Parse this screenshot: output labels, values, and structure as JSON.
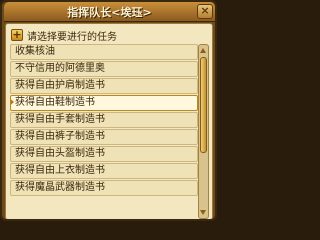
{
  "window": {
    "title": "指挥队长<埃珏>",
    "close_glyph": "×"
  },
  "prompt": {
    "icon": "plus-icon",
    "text": "请选择要进行的任务"
  },
  "tasks": [
    {
      "label": "收集核油",
      "selected": false
    },
    {
      "label": "不守信用的阿德里奥",
      "selected": false
    },
    {
      "label": "获得自由护肩制造书",
      "selected": false
    },
    {
      "label": "获得自由鞋制造书",
      "selected": true
    },
    {
      "label": "获得自由手套制造书",
      "selected": false
    },
    {
      "label": "获得自由裤子制造书",
      "selected": false
    },
    {
      "label": "获得自由头盔制造书",
      "selected": false
    },
    {
      "label": "获得自由上衣制造书",
      "selected": false
    },
    {
      "label": "获得魔晶武器制造书",
      "selected": false
    }
  ],
  "colors": {
    "accent": "#b37a12",
    "panel_bg": "#f3e7bf",
    "frame": "#6b4a1e"
  }
}
